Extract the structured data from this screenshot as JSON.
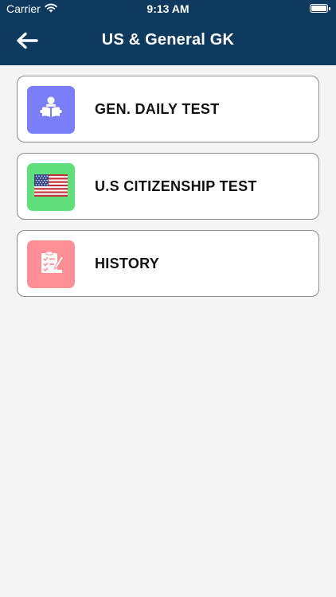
{
  "status": {
    "carrier": "Carrier",
    "time": "9:13 AM"
  },
  "header": {
    "title": "US & General GK",
    "back_icon": "back-arrow-icon"
  },
  "items": [
    {
      "label": "GEN. DAILY TEST",
      "icon": "reading-student-icon",
      "color": "#7a7ff7"
    },
    {
      "label": "U.S CITIZENSHIP TEST",
      "icon": "us-flag-icon",
      "color": "#5fe07a"
    },
    {
      "label": "HISTORY",
      "icon": "checklist-edit-icon",
      "color": "#ff8f95"
    }
  ],
  "colors": {
    "nav_bg": "#0f3a5f",
    "page_bg": "#f4f4f4"
  }
}
